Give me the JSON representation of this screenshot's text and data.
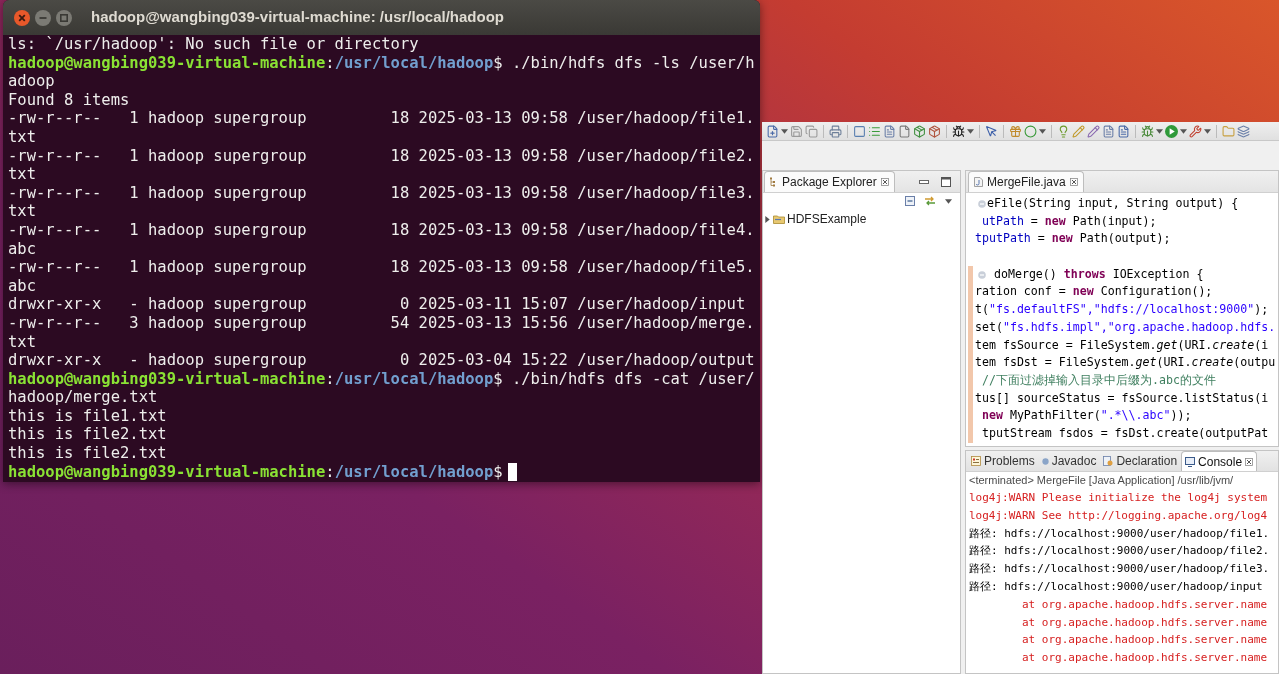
{
  "terminal": {
    "title": "hadoop@wangbing039-virtual-machine: /usr/local/hadoop",
    "lines": [
      {
        "kind": "output",
        "text": "ls: `/usr/hadoop': No such file or directory"
      },
      {
        "kind": "prompt",
        "user": "hadoop@wangbing039-virtual-machine",
        "sep": ":",
        "path": "/usr/local/hadoop",
        "input": "$ ./bin/hdfs dfs -ls /user/hadoop",
        "cursor": false
      },
      {
        "kind": "output",
        "text": "Found 8 items"
      },
      {
        "kind": "output",
        "text": "-rw-r--r--   1 hadoop supergroup         18 2025-03-13 09:58 /user/hadoop/file1.txt"
      },
      {
        "kind": "output",
        "text": "-rw-r--r--   1 hadoop supergroup         18 2025-03-13 09:58 /user/hadoop/file2.txt"
      },
      {
        "kind": "output",
        "text": "-rw-r--r--   1 hadoop supergroup         18 2025-03-13 09:58 /user/hadoop/file3.txt"
      },
      {
        "kind": "output",
        "text": "-rw-r--r--   1 hadoop supergroup         18 2025-03-13 09:58 /user/hadoop/file4.abc"
      },
      {
        "kind": "output",
        "text": "-rw-r--r--   1 hadoop supergroup         18 2025-03-13 09:58 /user/hadoop/file5.abc"
      },
      {
        "kind": "output",
        "text": "drwxr-xr-x   - hadoop supergroup          0 2025-03-11 15:07 /user/hadoop/input"
      },
      {
        "kind": "output",
        "text": "-rw-r--r--   3 hadoop supergroup         54 2025-03-13 15:56 /user/hadoop/merge.txt"
      },
      {
        "kind": "output",
        "text": "drwxr-xr-x   - hadoop supergroup          0 2025-03-04 15:22 /user/hadoop/output"
      },
      {
        "kind": "prompt",
        "user": "hadoop@wangbing039-virtual-machine",
        "sep": ":",
        "path": "/usr/local/hadoop",
        "input": "$ ./bin/hdfs dfs -cat /user/hadoop/merge.txt",
        "cursor": false
      },
      {
        "kind": "output",
        "text": "this is file1.txt"
      },
      {
        "kind": "output",
        "text": "this is file2.txt"
      },
      {
        "kind": "output",
        "text": "this is file2.txt"
      },
      {
        "kind": "prompt",
        "user": "hadoop@wangbing039-virtual-machine",
        "sep": ":",
        "path": "/usr/local/hadoop",
        "input": "$",
        "cursor": true
      }
    ]
  },
  "eclipse": {
    "package_explorer": {
      "tab": "Package Explorer",
      "tree": [
        {
          "label": "HDFSExample",
          "expanded": false
        }
      ]
    },
    "editor": {
      "tab": "MergeFile.java",
      "lines": [
        {
          "kind": "code",
          "fold_marker": true,
          "changed": false,
          "segments": [
            {
              "kind": "plain",
              "text": "eFile(String input, String output) {"
            }
          ]
        },
        {
          "kind": "code",
          "fold_marker": false,
          "changed": false,
          "segments": [
            {
              "kind": "field",
              "text": " utPath"
            },
            {
              "kind": "plain",
              "text": " = "
            },
            {
              "kind": "keyword",
              "text": "new"
            },
            {
              "kind": "plain",
              "text": " Path(input);"
            }
          ]
        },
        {
          "kind": "code",
          "fold_marker": false,
          "changed": false,
          "segments": [
            {
              "kind": "field",
              "text": "tputPath"
            },
            {
              "kind": "plain",
              "text": " = "
            },
            {
              "kind": "keyword",
              "text": "new"
            },
            {
              "kind": "plain",
              "text": " Path(output);"
            }
          ]
        },
        {
          "kind": "blank",
          "fold_marker": false,
          "changed": false
        },
        {
          "kind": "code",
          "fold_marker": true,
          "changed": true,
          "segments": [
            {
              "kind": "plain",
              "text": " doMerge() "
            },
            {
              "kind": "keyword",
              "text": "throws"
            },
            {
              "kind": "plain",
              "text": " IOException {"
            }
          ]
        },
        {
          "kind": "code",
          "fold_marker": false,
          "changed": true,
          "segments": [
            {
              "kind": "plain",
              "text": "ration conf = "
            },
            {
              "kind": "keyword",
              "text": "new"
            },
            {
              "kind": "plain",
              "text": " Configuration();"
            }
          ]
        },
        {
          "kind": "code",
          "fold_marker": false,
          "changed": true,
          "segments": [
            {
              "kind": "plain",
              "text": "t("
            },
            {
              "kind": "string",
              "text": "\"fs.defaultFS\","
            },
            {
              "kind": "string",
              "text": "\"hdfs://localhost:9000\""
            },
            {
              "kind": "plain",
              "text": ");"
            }
          ]
        },
        {
          "kind": "code",
          "fold_marker": false,
          "changed": true,
          "segments": [
            {
              "kind": "plain",
              "text": "set("
            },
            {
              "kind": "string",
              "text": "\"fs.hdfs.impl\","
            },
            {
              "kind": "string",
              "text": "\"org.apache.hadoop.hdfs."
            }
          ]
        },
        {
          "kind": "code",
          "fold_marker": false,
          "changed": true,
          "segments": [
            {
              "kind": "plain",
              "text": "tem fsSource = FileSystem."
            },
            {
              "kind": "static",
              "text": "get"
            },
            {
              "kind": "plain",
              "text": "(URI."
            },
            {
              "kind": "static",
              "text": "create"
            },
            {
              "kind": "plain",
              "text": "(i"
            }
          ]
        },
        {
          "kind": "code",
          "fold_marker": false,
          "changed": true,
          "segments": [
            {
              "kind": "plain",
              "text": "tem fsDst = FileSystem."
            },
            {
              "kind": "static",
              "text": "get"
            },
            {
              "kind": "plain",
              "text": "(URI."
            },
            {
              "kind": "static",
              "text": "create"
            },
            {
              "kind": "plain",
              "text": "(outpu"
            }
          ]
        },
        {
          "kind": "code",
          "fold_marker": false,
          "changed": true,
          "segments": [
            {
              "kind": "comment",
              "text": " //下面过滤掉输入目录中后缀为.abc的文件"
            }
          ]
        },
        {
          "kind": "code",
          "fold_marker": false,
          "changed": true,
          "segments": [
            {
              "kind": "plain",
              "text": "tus[] sourceStatus = fsSource.listStatus(i"
            }
          ]
        },
        {
          "kind": "code",
          "fold_marker": false,
          "changed": true,
          "segments": [
            {
              "kind": "keyword",
              "text": " new"
            },
            {
              "kind": "plain",
              "text": " MyPathFilter("
            },
            {
              "kind": "string",
              "text": "\".*\\\\.abc\""
            },
            {
              "kind": "plain",
              "text": "));"
            }
          ]
        },
        {
          "kind": "code",
          "fold_marker": false,
          "changed": true,
          "segments": [
            {
              "kind": "plain",
              "text": " tputStream fsdos = fsDst.create(outputPat"
            }
          ]
        }
      ]
    },
    "bottom_panel": {
      "tabs": [
        {
          "kind": "problems",
          "label": "Problems",
          "selected": false
        },
        {
          "kind": "javadoc",
          "label": "Javadoc",
          "selected": false
        },
        {
          "kind": "declaration",
          "label": "Declaration",
          "selected": false
        },
        {
          "kind": "console",
          "label": "Console",
          "selected": true
        }
      ],
      "console": {
        "status": "<terminated> MergeFile [Java Application] /usr/lib/jvm/",
        "lines": [
          {
            "kind": "error",
            "text": "log4j:WARN Please initialize the log4j system"
          },
          {
            "kind": "error",
            "text": "log4j:WARN See http://logging.apache.org/log4"
          },
          {
            "kind": "output",
            "text": "路径: hdfs://localhost:9000/user/hadoop/file1."
          },
          {
            "kind": "output",
            "text": "路径: hdfs://localhost:9000/user/hadoop/file2."
          },
          {
            "kind": "output",
            "text": "路径: hdfs://localhost:9000/user/hadoop/file3."
          },
          {
            "kind": "output",
            "text": "路径: hdfs://localhost:9000/user/hadoop/input"
          },
          {
            "kind": "error",
            "text": "\tat org.apache.hadoop.hdfs.server.name"
          },
          {
            "kind": "error",
            "text": "\tat org.apache.hadoop.hdfs.server.name"
          },
          {
            "kind": "error",
            "text": "\tat org.apache.hadoop.hdfs.server.name"
          },
          {
            "kind": "error",
            "text": "\tat org.apache.hadoop.hdfs.server.name"
          }
        ]
      }
    }
  }
}
